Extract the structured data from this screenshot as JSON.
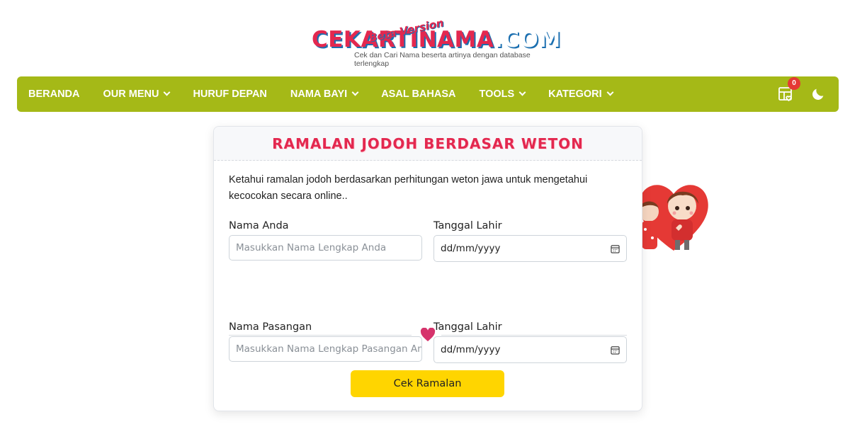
{
  "logo": {
    "main_text": "CEKARTINAMA",
    "dot_com": ".COM",
    "beta_text": "Beta Version",
    "tagline": "Cek dan Cari Nama beserta artinya dengan database terlengkap"
  },
  "nav": {
    "items": [
      {
        "label": "BERANDA",
        "dropdown": false
      },
      {
        "label": "OUR MENU",
        "dropdown": true
      },
      {
        "label": "HURUF DEPAN",
        "dropdown": false
      },
      {
        "label": "NAMA BAYI",
        "dropdown": true
      },
      {
        "label": "ASAL BAHASA",
        "dropdown": false
      },
      {
        "label": "TOOLS",
        "dropdown": true
      },
      {
        "label": "KATEGORI",
        "dropdown": true
      }
    ],
    "cart_count": "0",
    "cart_icon": "cart-icon",
    "theme_icon": "moon-icon"
  },
  "card": {
    "title": "RAMALAN JODOH BERDASAR WETON",
    "description": "Ketahui ramalan jodoh berdasarkan perhitungan weton jawa untuk mengetahui kecocokan secara online..",
    "person1": {
      "name_label": "Nama Anda",
      "name_placeholder": "Masukkan Nama Lengkap Anda",
      "date_label": "Tanggal Lahir",
      "date_value": "dd/mm/yyyy"
    },
    "person2": {
      "name_label": "Nama Pasangan",
      "name_placeholder": "Masukkan Nama Lengkap Pasangan An",
      "date_label": "Tanggal Lahir",
      "date_value": "dd/mm/yyyy"
    },
    "submit_label": "Cek Ramalan"
  },
  "colors": {
    "nav_bg": "#a5b917",
    "title_red": "#e3284f",
    "heart": "#d6336c",
    "button_yellow": "#ffd500",
    "badge_red": "#e53935"
  }
}
